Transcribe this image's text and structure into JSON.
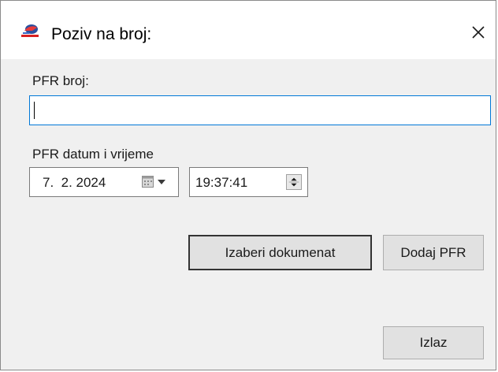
{
  "window": {
    "title": "Poziv na broj:",
    "app_icon": "app-logo-icon",
    "close_icon": "close-icon"
  },
  "form": {
    "pfr_number_label": "PFR broj:",
    "pfr_number_value": "",
    "pfr_datetime_label": "PFR datum i vrijeme",
    "date_value": "7.  2. 2024",
    "time_value": "19:37:41",
    "calendar_icon": "calendar-icon",
    "dropdown_icon": "chevron-down-icon",
    "spinner_icon": "spin-up-down-icon"
  },
  "buttons": {
    "select_document": "Izaberi dokumenat",
    "add_pfr": "Dodaj PFR",
    "exit": "Izlaz"
  },
  "colors": {
    "focus_border": "#0078d7",
    "dialog_background": "#f0f0f0",
    "button_background": "#e1e1e1"
  }
}
